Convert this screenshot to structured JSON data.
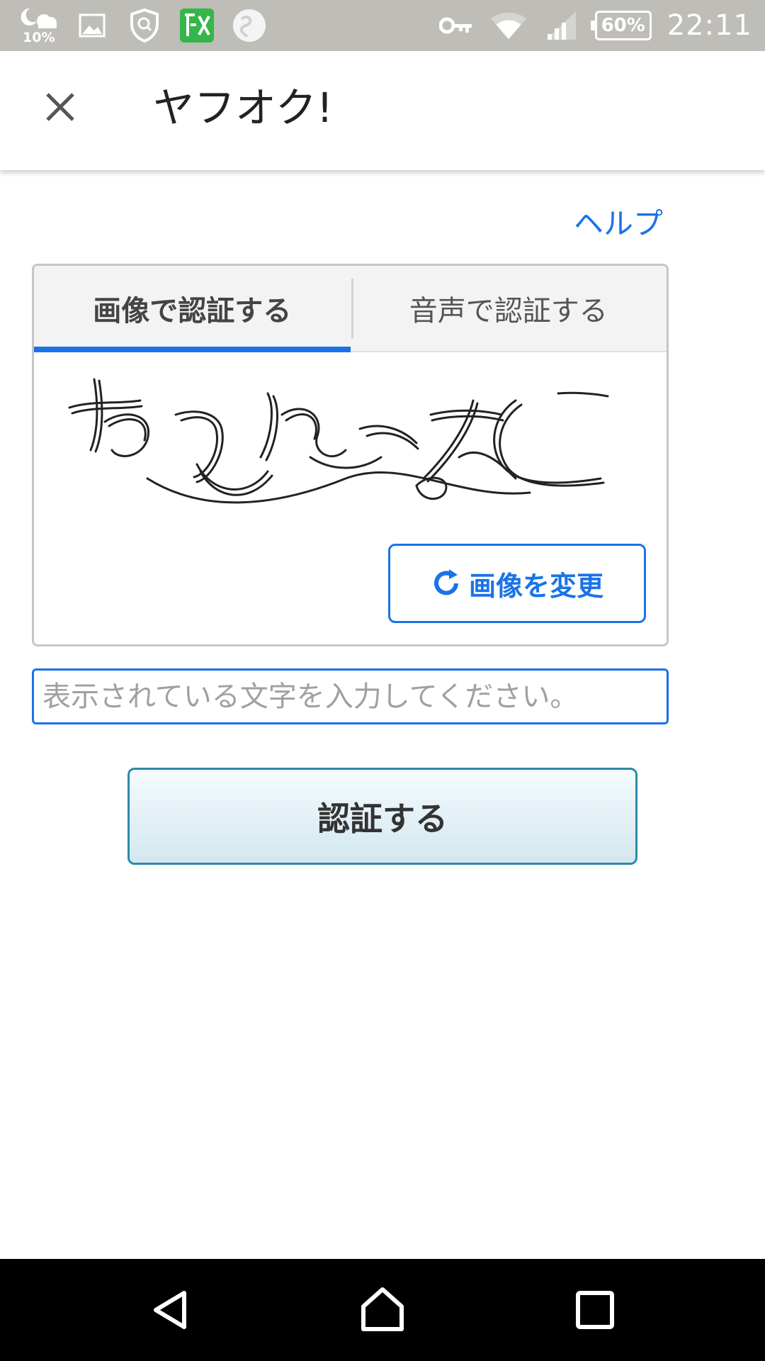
{
  "status_bar": {
    "weather_percent": "10%",
    "battery_percent": "60%",
    "time": "22:11",
    "icons": [
      "weather-icon",
      "image-icon",
      "shield-icon",
      "app-icon",
      "globe-icon",
      "key-icon",
      "wifi-icon",
      "signal-icon",
      "battery-icon"
    ]
  },
  "app_bar": {
    "title": "ヤフオク!",
    "close_icon": "close-icon"
  },
  "help": {
    "label": "ヘルプ"
  },
  "captcha": {
    "tabs": [
      {
        "label": "画像で認証する",
        "active": true
      },
      {
        "label": "音声で認証する",
        "active": false
      }
    ],
    "refresh_label": "画像を変更",
    "refresh_icon": "refresh-icon"
  },
  "answer": {
    "placeholder": "表示されている文字を入力してください。",
    "value": ""
  },
  "submit": {
    "label": "認証する"
  },
  "nav": {
    "icons": [
      "back-icon",
      "home-icon",
      "recents-icon"
    ]
  },
  "colors": {
    "accent": "#1a73e8",
    "status_bar": "#bfbdb8",
    "submit_border": "#2d8aa8"
  }
}
